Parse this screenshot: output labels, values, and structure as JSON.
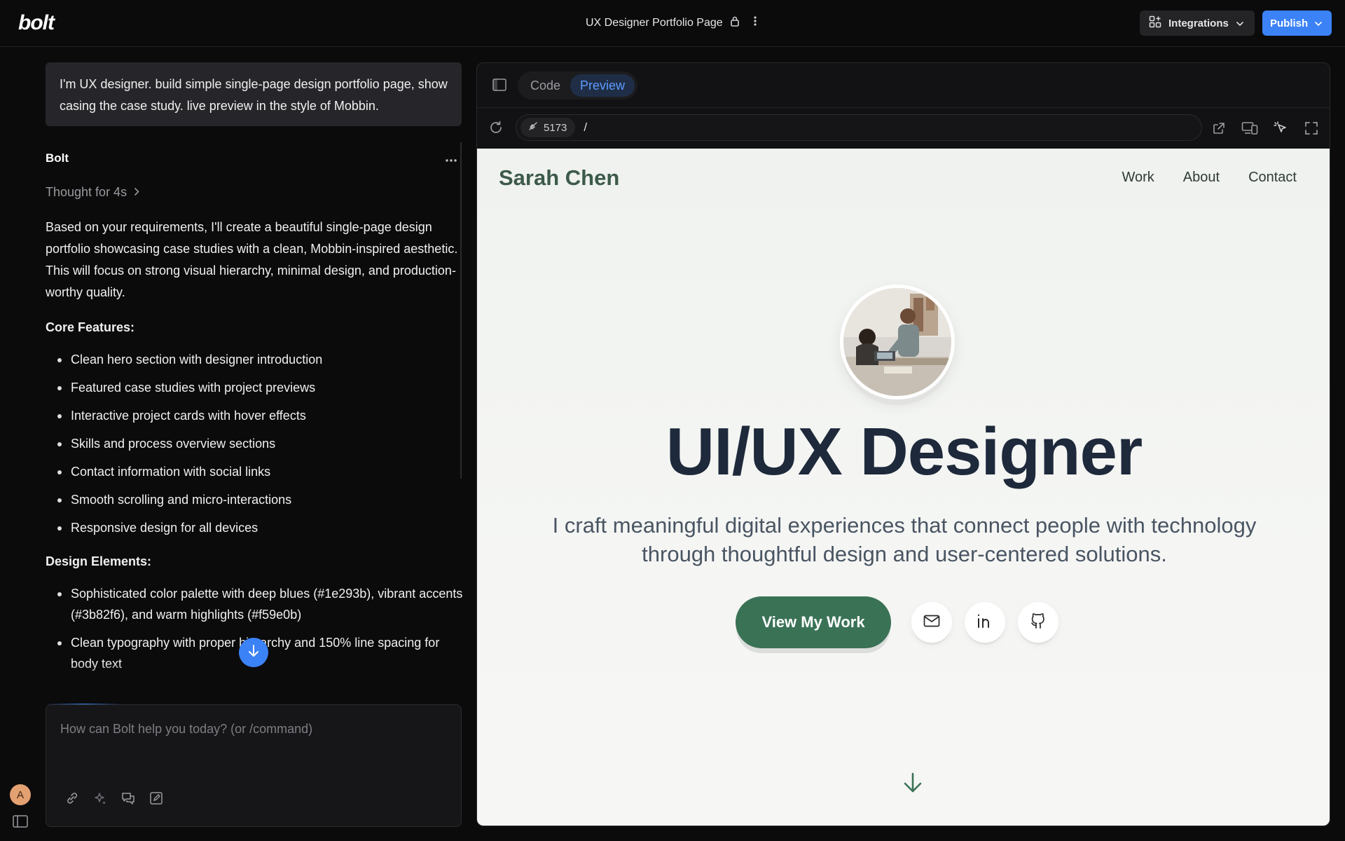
{
  "topbar": {
    "logo": "bolt",
    "project_title": "UX Designer Portfolio Page",
    "integrations_label": "Integrations",
    "publish_label": "Publish"
  },
  "chat": {
    "user_prompt": "I'm UX designer. build simple single-page design portfolio page, show casing the case study. live preview in the style of Mobbin.",
    "assistant_name": "Bolt",
    "thought_label": "Thought for 4s",
    "intro": "Based on your requirements, I'll create a beautiful single-page design portfolio showcasing case studies with a clean, Mobbin-inspired aesthetic. This will focus on strong visual hierarchy, minimal design, and production-worthy quality.",
    "core_heading": "Core Features:",
    "core_features": [
      "Clean hero section with designer introduction",
      "Featured case studies with project previews",
      "Interactive project cards with hover effects",
      "Skills and process overview sections",
      "Contact information with social links",
      "Smooth scrolling and micro-interactions",
      "Responsive design for all devices"
    ],
    "design_heading": "Design Elements:",
    "design_elements": [
      "Sophisticated color palette with deep blues (#1e293b), vibrant accents (#3b82f6), and warm highlights (#f59e0b)",
      "Clean typography with proper hierarchy and 150% line spacing for body text"
    ],
    "input_placeholder": "How can Bolt help you today? (or /command)",
    "user_avatar_initial": "A"
  },
  "preview": {
    "tabs": [
      "Code",
      "Preview"
    ],
    "active_tab": "Preview",
    "port": "5173",
    "url_path": "/"
  },
  "site": {
    "name": "Sarah Chen",
    "nav": [
      "Work",
      "About",
      "Contact"
    ],
    "hero_title": "UI/UX Designer",
    "hero_subtitle": "I craft meaningful digital experiences that connect people with technology through thoughtful design and user-centered solutions.",
    "cta_label": "View My Work"
  },
  "colors": {
    "accent": "#3b82f6",
    "site_green": "#3a7256",
    "site_heading": "#1e293b"
  }
}
